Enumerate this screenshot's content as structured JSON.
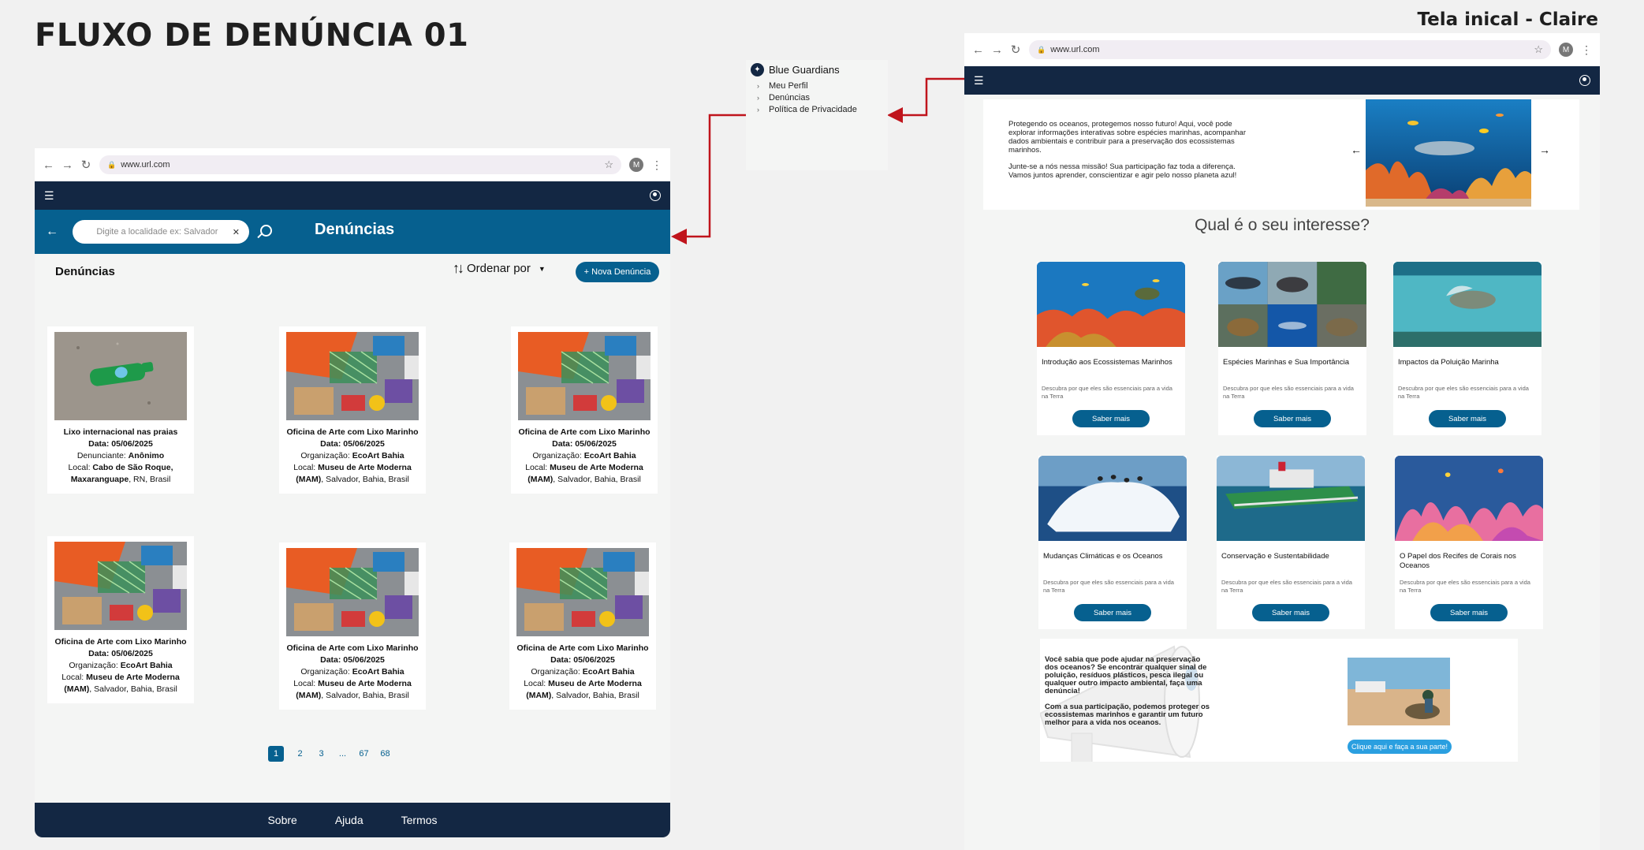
{
  "board": {
    "title": "FLUXO DE DENÚNCIA 01",
    "subtitle": "Tela inical - Claire"
  },
  "browser": {
    "url": "www.url.com",
    "avatar_letter": "M"
  },
  "menu": {
    "brand": "Blue Guardians",
    "items": [
      "Meu Perfil",
      "Denúncias",
      "Política de Privacidade"
    ]
  },
  "reports_page": {
    "search_placeholder": "Digite a localidade ex: Salvador",
    "header_title": "Denúncias",
    "list_title": "Denúncias",
    "sort_label": "Ordenar por",
    "new_button": "+ Nova Denúncia",
    "cards": [
      {
        "title": "Lixo internacional nas praias",
        "date": "Data: 05/06/2025",
        "role_label": "Denunciante:",
        "role_value": "Anônimo",
        "loc_label": "Local:",
        "loc_bold": "Cabo de São Roque, Maxaranguape",
        "loc_rest": ", RN, Brasil",
        "image": "bottle-on-sand"
      },
      {
        "title": "Oficina de Arte com Lixo Marinho",
        "date": "Data: 05/06/2025",
        "role_label": "Organização:",
        "role_value": "EcoArt Bahia",
        "loc_label": "Local:",
        "loc_bold": "Museu de Arte Moderna (MAM)",
        "loc_rest": ", Salvador, Bahia, Brasil",
        "image": "plastic-debris"
      },
      {
        "title": "Oficina de Arte com Lixo Marinho",
        "date": "Data: 05/06/2025",
        "role_label": "Organização:",
        "role_value": "EcoArt Bahia",
        "loc_label": "Local:",
        "loc_bold": "Museu de Arte Moderna (MAM)",
        "loc_rest": ", Salvador, Bahia, Brasil",
        "image": "plastic-debris"
      },
      {
        "title": "Oficina de Arte com Lixo Marinho",
        "date": "Data: 05/06/2025",
        "role_label": "Organização:",
        "role_value": "EcoArt Bahia",
        "loc_label": "Local:",
        "loc_bold": "Museu de Arte Moderna (MAM)",
        "loc_rest": ", Salvador, Bahia, Brasil",
        "image": "plastic-debris"
      },
      {
        "title": "Oficina de Arte com Lixo Marinho",
        "date": "Data: 05/06/2025",
        "role_label": "Organização:",
        "role_value": "EcoArt Bahia",
        "loc_label": "Local:",
        "loc_bold": "Museu de Arte Moderna (MAM)",
        "loc_rest": ", Salvador, Bahia, Brasil",
        "image": "plastic-debris"
      },
      {
        "title": "Oficina de Arte com Lixo Marinho",
        "date": "Data: 05/06/2025",
        "role_label": "Organização:",
        "role_value": "EcoArt Bahia",
        "loc_label": "Local:",
        "loc_bold": "Museu de Arte Moderna (MAM)",
        "loc_rest": ", Salvador, Bahia, Brasil",
        "image": "plastic-debris"
      }
    ],
    "pagination": [
      "1",
      "2",
      "3",
      "...",
      "67",
      "68"
    ],
    "footer": [
      "Sobre",
      "Ajuda",
      "Termos"
    ]
  },
  "home_page": {
    "hero_p1": "Protegendo os oceanos, protegemos nosso futuro! Aqui, você pode explorar informações interativas sobre espécies marinhas, acompanhar dados ambientais e contribuir para a preservação dos ecossistemas marinhos.",
    "hero_p2": "Junte-se a nós nessa missão! Sua participação faz toda a diferença. Vamos juntos aprender, conscientizar e agir pelo nosso planeta azul!",
    "question": "Qual é o seu interesse?",
    "topics": [
      {
        "title": "Introdução aos Ecossistemas Marinhos",
        "desc": "Descubra por que eles são essenciais para a vida na Terra",
        "button": "Saber mais",
        "image": "reef-turtle"
      },
      {
        "title": "Espécies Marinhas e Sua Importância",
        "desc": "Descubra por que eles são essenciais para a vida na Terra",
        "button": "Saber mais",
        "image": "species-grid"
      },
      {
        "title": "Impactos da Poluição Marinha",
        "desc": "Descubra por que eles são essenciais para a vida na Terra",
        "button": "Saber mais",
        "image": "turtle-bag"
      },
      {
        "title": "Mudanças Climáticas e os Oceanos",
        "desc": "Descubra por que eles são essenciais para a vida na Terra",
        "button": "Saber mais",
        "image": "iceberg-penguins"
      },
      {
        "title": "Conservação e Sustentabilidade",
        "desc": "Descubra por que eles são essenciais para a vida na Terra",
        "button": "Saber mais",
        "image": "arctic-ship"
      },
      {
        "title": "O Papel dos Recifes de Corais nos Oceanos",
        "desc": "Descubra por que eles são essenciais para a vida na Terra",
        "button": "Saber mais",
        "image": "coral-reef"
      }
    ],
    "cta_p1": "Você sabia que pode ajudar na preservação dos oceanos? Se encontrar qualquer sinal de poluição, resíduos plásticos, pesca ilegal ou qualquer outro impacto ambiental, faça uma denúncia!",
    "cta_p2": "Com a sua participação, podemos proteger os ecossistemas marinhos e garantir um futuro melhor para a vida nos oceanos.",
    "cta_button": "Clique aqui e faça a sua parte!"
  },
  "colors": {
    "navy": "#132743",
    "primary_blue": "#06608f",
    "cta_blue": "#2a9fe0",
    "connector_red": "#c0141c"
  }
}
